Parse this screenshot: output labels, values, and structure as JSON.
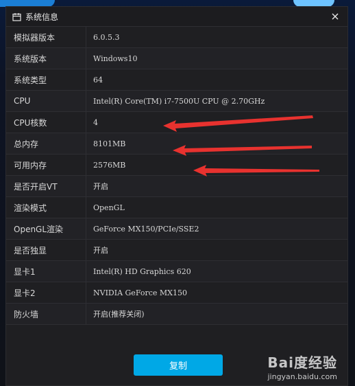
{
  "dialog": {
    "title": "系统信息",
    "title_icon": "calendar-icon",
    "close_icon": "close-icon"
  },
  "rows": [
    {
      "label": "模拟器版本",
      "value": "6.0.5.3"
    },
    {
      "label": "系统版本",
      "value": "Windows10"
    },
    {
      "label": "系统类型",
      "value": "64"
    },
    {
      "label": "CPU",
      "value": "Intel(R) Core(TM) i7-7500U CPU @ 2.70GHz"
    },
    {
      "label": "CPU核数",
      "value": "4"
    },
    {
      "label": "总内存",
      "value": "8101MB"
    },
    {
      "label": "可用内存",
      "value": "2576MB"
    },
    {
      "label": "是否开启VT",
      "value": "开启"
    },
    {
      "label": "渲染模式",
      "value": "OpenGL"
    },
    {
      "label": "OpenGL渲染",
      "value": "GeForce MX150/PCIe/SSE2"
    },
    {
      "label": "是否独显",
      "value": "开启"
    },
    {
      "label": "显卡1",
      "value": "Intel(R) HD Graphics 620"
    },
    {
      "label": "显卡2",
      "value": "NVIDIA GeForce MX150"
    },
    {
      "label": "防火墙",
      "value": "开启(推荐关闭)"
    }
  ],
  "copy_button": {
    "label": "复制"
  },
  "watermark": {
    "brand": "Bai度经验",
    "url": "jingyan.baidu.com"
  },
  "colors": {
    "accent": "#00a8e6",
    "arrow": "#e8322f",
    "dialog_bg": "#1f1f22"
  }
}
